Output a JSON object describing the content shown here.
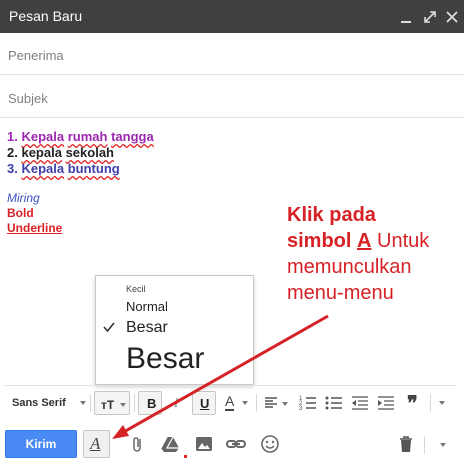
{
  "window": {
    "title": "Pesan Baru"
  },
  "recipients": {
    "placeholder": "Penerima"
  },
  "subject": {
    "placeholder": "Subjek"
  },
  "body": {
    "list": [
      {
        "num": "1.",
        "words": [
          "Kepala",
          "rumah",
          "tangga"
        ],
        "color": "#9c27b0"
      },
      {
        "num": "2.",
        "words": [
          "kepala",
          "sekolah"
        ],
        "color": "#222222"
      },
      {
        "num": "3.",
        "words": [
          "Kepala",
          "buntung"
        ],
        "color": "#3f3faa"
      }
    ],
    "italic_text": "Miring",
    "bold_text": "Bold",
    "underline_text": "Underline"
  },
  "annotation": {
    "line1": "Klik pada",
    "line2_bold": "simbol",
    "line2_symbol": "A",
    "line2_rest": "Untuk",
    "line3": "memunculkan",
    "line4": "menu-menu",
    "color": "#d62226"
  },
  "size_menu": {
    "items": [
      {
        "label": "Kecil"
      },
      {
        "label": "Normal"
      },
      {
        "label": "Besar",
        "checked": true
      },
      {
        "label": "Besar"
      }
    ]
  },
  "toolbar": {
    "font": "Sans Serif",
    "bold": "B",
    "italic": "I",
    "underline": "U",
    "text_color": "A",
    "quote": "❞"
  },
  "footer": {
    "send_label": "Kirim",
    "format_symbol": "A"
  },
  "colors": {
    "accent": "#4a8af4",
    "titlebar": "#404040",
    "annotation": "#d62226"
  }
}
